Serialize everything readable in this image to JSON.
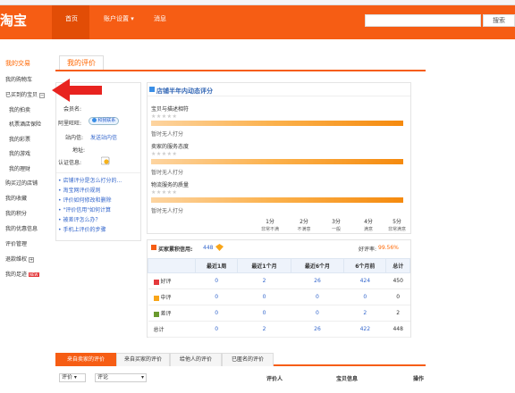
{
  "header": {
    "logo": "淘宝",
    "nav": [
      "首页",
      "账户设置 ▾",
      "消息"
    ],
    "search_button": "搜索"
  },
  "sidebar": {
    "group1": "我的交易",
    "items": [
      {
        "label": "我的购物车",
        "level": 1
      },
      {
        "label": "已买到的宝贝",
        "level": 1,
        "toggle": "−"
      },
      {
        "label": "我的拍卖",
        "level": 2
      },
      {
        "label": "机票酒店保险",
        "level": 2
      },
      {
        "label": "我的彩票",
        "level": 2
      },
      {
        "label": "我的游戏",
        "level": 2
      },
      {
        "label": "我的理财",
        "level": 2
      },
      {
        "label": "购买过的店铺",
        "level": 1
      },
      {
        "label": "我的收藏",
        "level": 1
      },
      {
        "label": "我的积分",
        "level": 1
      },
      {
        "label": "我的优惠信息",
        "level": 1
      },
      {
        "label": "评价管理",
        "level": 1
      },
      {
        "label": "退款维权",
        "level": 1,
        "toggle": "+"
      },
      {
        "label": "我的足迹",
        "level": 1,
        "badge": "NEW"
      }
    ]
  },
  "tabs": {
    "my_reviews": "我的评价"
  },
  "profile": {
    "username_label": "会员名:",
    "wangwang_label": "阿里旺旺:",
    "wangwang_status": "和我联系",
    "sitemail_label": "站内信:",
    "sitemail_link": "发送站内信",
    "address_label": "地址:",
    "cert_label": "认证信息:",
    "links": [
      "店铺评分是怎么打分的...",
      "淘宝网评价规则",
      "评价如何修改和删除",
      "\"评价信用\"如何计算",
      "被差评怎么办？",
      "手机上评价的步骤"
    ]
  },
  "rating": {
    "title": "店铺半年内动态评分",
    "rows": [
      {
        "label": "宝贝与描述相符",
        "stars": "★★★★★",
        "empty": "暂时无人打分"
      },
      {
        "label": "卖家的服务态度",
        "stars": "★★★★★",
        "empty": "暂时无人打分"
      },
      {
        "label": "物流服务的质量",
        "stars": "★★★★★",
        "empty": "暂时无人打分"
      }
    ],
    "scale": [
      {
        "num": "1分",
        "label": "非常不满"
      },
      {
        "num": "2分",
        "label": "不满意"
      },
      {
        "num": "3分",
        "label": "一般"
      },
      {
        "num": "4分",
        "label": "满意"
      },
      {
        "num": "5分",
        "label": "非常满意"
      }
    ]
  },
  "credit": {
    "title": "买家累积信用:",
    "score": "448",
    "rate_label": "好评率:",
    "rate_value": "99.56%",
    "columns": [
      "",
      "最近1周",
      "最近1个月",
      "最近6个月",
      "6个月前",
      "总计"
    ],
    "rows": [
      {
        "label": "好评",
        "values": [
          "0",
          "2",
          "26",
          "424",
          "450"
        ]
      },
      {
        "label": "中评",
        "values": [
          "0",
          "0",
          "0",
          "0",
          "0"
        ]
      },
      {
        "label": "差评",
        "values": [
          "0",
          "0",
          "0",
          "2",
          "2"
        ]
      },
      {
        "label": "总计",
        "values": [
          "0",
          "2",
          "26",
          "422",
          "448"
        ]
      }
    ]
  },
  "bottom_tabs": [
    "来自卖家的评价",
    "来自买家的评价",
    "给他人的评价",
    "已匿名的评价"
  ],
  "filter": {
    "select1": "评价 ▾",
    "select2": "评论",
    "col_reviewer": "评价人",
    "col_item": "宝贝信息",
    "col_action": "操作"
  },
  "colors": {
    "brand_orange": "#f65d14",
    "link_blue": "#3366cc",
    "arrow_red": "#e8231f"
  }
}
